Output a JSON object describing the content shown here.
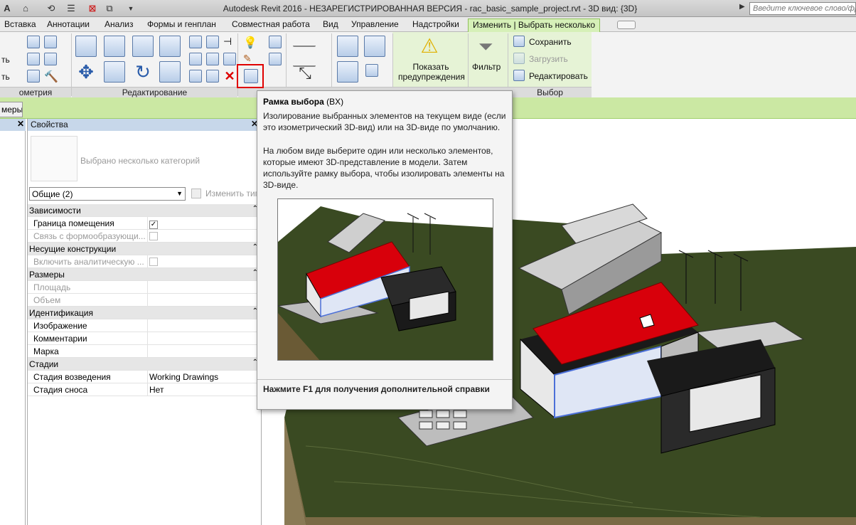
{
  "app": {
    "title": "Autodesk Revit 2016 - НЕЗАРЕГИСТРИРОВАННАЯ ВЕРСИЯ -    rac_basic_sample_project.rvt - 3D вид: {3D}",
    "search_placeholder": "Введите ключевое слово/фразу"
  },
  "tabs": [
    {
      "label": "Вставка"
    },
    {
      "label": "Аннотации"
    },
    {
      "label": "Анализ"
    },
    {
      "label": "Формы и генплан"
    },
    {
      "label": "Совместная работа"
    },
    {
      "label": "Вид"
    },
    {
      "label": "Управление"
    },
    {
      "label": "Надстройки"
    },
    {
      "label": "Изменить | Выбрать несколько"
    }
  ],
  "ribbon": {
    "panels": {
      "geometry": "ометрия",
      "edit": "Редактирование",
      "choose": "Выбор"
    },
    "left_labels": [
      "ть",
      "ть"
    ],
    "show_warnings": "Показать предупреждения",
    "filter": "Фильтр",
    "save": "Сохранить",
    "load": "Загрузить",
    "edit_sel": "Редактировать"
  },
  "context_tab": "меры",
  "properties": {
    "header": "Свойства",
    "type_name": "Выбрано несколько категорий",
    "type_select": "Общие (2)",
    "edit_type": "Изменить тип",
    "rows": [
      {
        "kind": "group",
        "name": "Зависимости"
      },
      {
        "kind": "row",
        "name": "Граница помещения",
        "check": "checked"
      },
      {
        "kind": "row",
        "name": "Связь с формообразующи...",
        "check": "disabled",
        "gray": true
      },
      {
        "kind": "group",
        "name": "Несущие конструкции"
      },
      {
        "kind": "row",
        "name": "Включить аналитическую ...",
        "check": "disabled",
        "gray": true
      },
      {
        "kind": "group",
        "name": "Размеры"
      },
      {
        "kind": "row",
        "name": "Площадь",
        "gray": true
      },
      {
        "kind": "row",
        "name": "Объем",
        "gray": true
      },
      {
        "kind": "group",
        "name": "Идентификация"
      },
      {
        "kind": "row",
        "name": "Изображение"
      },
      {
        "kind": "row",
        "name": "Комментарии"
      },
      {
        "kind": "row",
        "name": "Марка"
      },
      {
        "kind": "group",
        "name": "Стадии"
      },
      {
        "kind": "row",
        "name": "Стадия возведения",
        "value": "Working Drawings"
      },
      {
        "kind": "row",
        "name": "Стадия сноса",
        "value": "Нет"
      }
    ]
  },
  "tooltip": {
    "title": "Рамка выбора",
    "shortcut": "(BX)",
    "para1": "Изолирование выбранных элементов на текущем виде (если это изометрический 3D-вид) или на 3D-виде по умолчанию.",
    "para2": "На любом виде выберите один или несколько элементов, которые имеют 3D-представление в модели. Затем используйте рамку выбора, чтобы изолировать элементы на 3D-виде.",
    "footer": "Нажмите F1 для получения дополнительной справки"
  },
  "colors": {
    "roof_red": "#d8000b",
    "ground_dark": "#3a4a22",
    "selection_blue": "#4b6fd8",
    "ribbon_green": "#cbe8a3"
  }
}
